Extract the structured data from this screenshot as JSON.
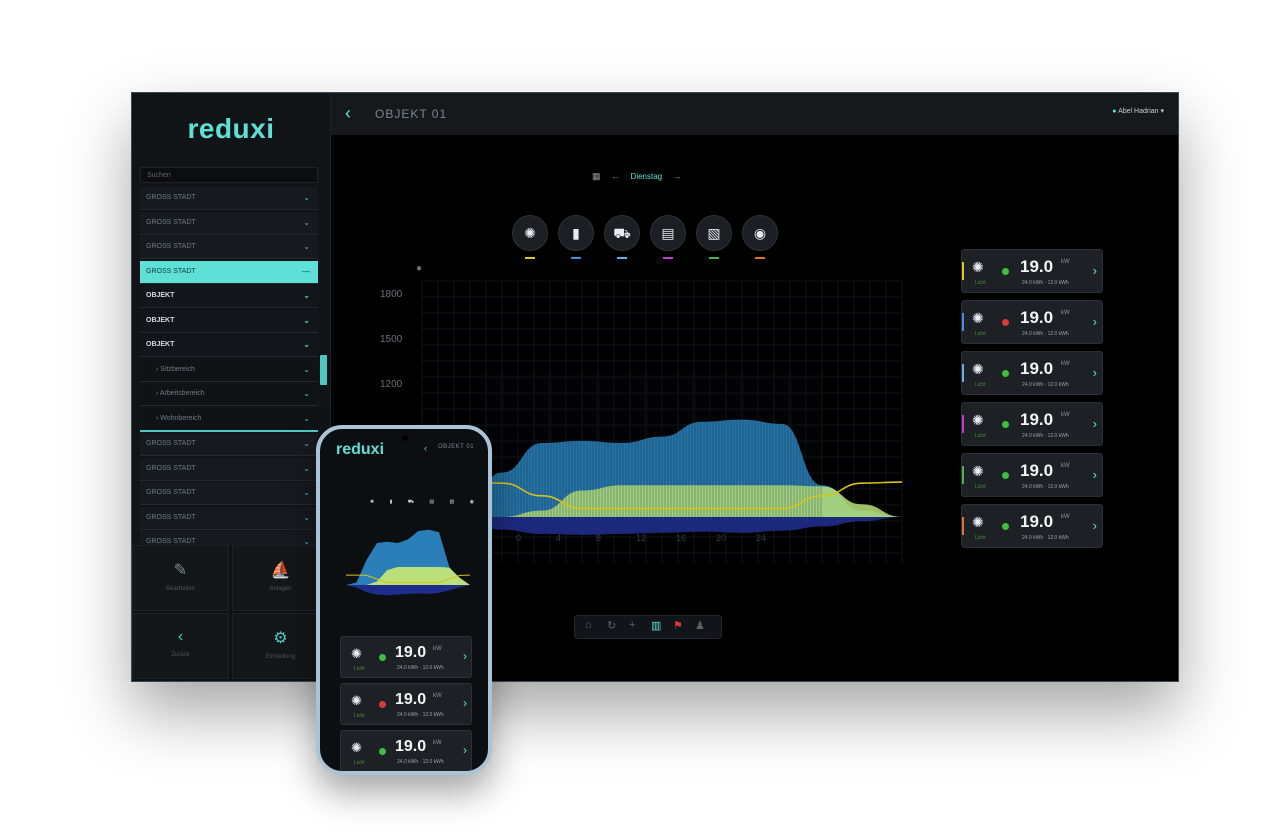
{
  "app": {
    "logo": "reduxi"
  },
  "header": {
    "back_glyph": "‹",
    "title": "OBJEKT 01",
    "user_name": "Abel Hadrian"
  },
  "sidebar": {
    "search_placeholder": "Suchen",
    "items": [
      {
        "label": "GROSS STADT",
        "state": "default"
      },
      {
        "label": "GROSS STADT",
        "state": "default"
      },
      {
        "label": "GROSS STADT",
        "state": "default"
      },
      {
        "label": "GROSS STADT",
        "state": "active"
      },
      {
        "label": "OBJEKT",
        "state": "bold"
      },
      {
        "label": "OBJEKT",
        "state": "bold"
      },
      {
        "label": "OBJEKT",
        "state": "bold"
      },
      {
        "label": "› Sitzbereich",
        "state": "sub"
      },
      {
        "label": "› Arbeitsbereich",
        "state": "sub"
      },
      {
        "label": "› Wohnbereich",
        "state": "sub-line"
      },
      {
        "label": "GROSS STADT",
        "state": "default"
      },
      {
        "label": "GROSS STADT",
        "state": "default"
      },
      {
        "label": "GROSS STADT",
        "state": "default"
      },
      {
        "label": "GROSS STADT",
        "state": "default"
      },
      {
        "label": "GROSS STADT",
        "state": "default"
      }
    ],
    "tiles": [
      {
        "icon": "edit-icon",
        "glyph": "✎",
        "label": "Bearbeiten"
      },
      {
        "icon": "boat-icon",
        "glyph": "⛵",
        "label": "Anlagen"
      },
      {
        "icon": "back-icon",
        "glyph": "‹",
        "label": "Zurück"
      },
      {
        "icon": "settings-icon",
        "glyph": "⚙",
        "label": "Einstellung"
      }
    ]
  },
  "date_nav": {
    "calendar_glyph": "▦",
    "prev_glyph": "←",
    "date": "Dienstag",
    "next_glyph": "→"
  },
  "categories": [
    {
      "icon": "light-icon",
      "glyph": "✺",
      "color": "#d9c81f"
    },
    {
      "icon": "battery-icon",
      "glyph": "▮",
      "color": "#3d8fe3"
    },
    {
      "icon": "car-icon",
      "glyph": "⛟",
      "color": "#5fb0e6"
    },
    {
      "icon": "appliance-icon",
      "glyph": "▤",
      "color": "#c23ad6"
    },
    {
      "icon": "document-icon",
      "glyph": "▧",
      "color": "#49b34d"
    },
    {
      "icon": "gauge-icon",
      "glyph": "◉",
      "color": "#e0742b"
    }
  ],
  "chart_data": {
    "type": "area",
    "y_ticks": [
      "1800",
      "1500",
      "1200"
    ],
    "x_ticks": [
      "0",
      "4",
      "8",
      "12",
      "16",
      "20",
      "24"
    ],
    "series": [
      {
        "values": [
          0,
          40,
          420,
          700,
          720,
          700,
          760,
          900,
          920,
          880,
          300,
          60,
          0
        ]
      },
      {
        "values": [
          0,
          0,
          0,
          60,
          250,
          300,
          300,
          300,
          300,
          300,
          290,
          120,
          0
        ]
      },
      {
        "values": [
          0,
          -40,
          -120,
          -160,
          -170,
          -160,
          -150,
          -140,
          -150,
          -130,
          -90,
          -40,
          0
        ]
      },
      {
        "values": [
          330,
          330,
          320,
          200,
          80,
          80,
          80,
          80,
          80,
          80,
          200,
          320,
          330
        ]
      }
    ]
  },
  "toolbar_icons": [
    {
      "icon": "home-icon",
      "glyph": "⌂"
    },
    {
      "icon": "refresh-icon",
      "glyph": "↻"
    },
    {
      "icon": "plus-icon",
      "glyph": "+"
    },
    {
      "icon": "chart-icon",
      "glyph": "▥"
    },
    {
      "icon": "alert-icon",
      "glyph": "⚑"
    },
    {
      "icon": "user-icon",
      "glyph": "♟"
    }
  ],
  "devices": [
    {
      "value": "19.0",
      "unit": "kW",
      "sub": "24.0 kWh · 12.0 kWh",
      "status": "#3fbf3f",
      "edge": "#d9c81f",
      "bulb_label": "Licht"
    },
    {
      "value": "19.0",
      "unit": "kW",
      "sub": "24.0 kWh · 12.0 kWh",
      "status": "#d93a3a",
      "edge": "#3d8fe3",
      "bulb_label": "Licht"
    },
    {
      "value": "19.0",
      "unit": "kW",
      "sub": "24.0 kWh · 12.0 kWh",
      "status": "#3fbf3f",
      "edge": "#5fb0e6",
      "bulb_label": "Licht"
    },
    {
      "value": "19.0",
      "unit": "kW",
      "sub": "24.0 kWh · 12.0 kWh",
      "status": "#3fbf3f",
      "edge": "#c23ad6",
      "bulb_label": "Licht"
    },
    {
      "value": "19.0",
      "unit": "kW",
      "sub": "24.0 kWh · 12.0 kWh",
      "status": "#3fbf3f",
      "edge": "#49b34d",
      "bulb_label": "Licht"
    },
    {
      "value": "19.0",
      "unit": "kW",
      "sub": "24.0 kWh · 12.0 kWh",
      "status": "#3fbf3f",
      "edge": "#e0742b",
      "bulb_label": "Licht"
    }
  ],
  "phone": {
    "logo": "reduxi",
    "title": "OBJEKT 01",
    "category_glyphs": "✺ ▮ ⛟ ▤ ▧ ◉",
    "devices": [
      {
        "value": "19.0",
        "unit": "kW",
        "sub": "24.0 kWh · 12.0 kWh",
        "status": "#3fbf3f",
        "bulb_label": "Licht"
      },
      {
        "value": "19.0",
        "unit": "kW",
        "sub": "24.0 kWh · 12.0 kWh",
        "status": "#d93a3a",
        "bulb_label": "Licht"
      },
      {
        "value": "19.0",
        "unit": "kW",
        "sub": "24.0 kWh · 12.0 kWh",
        "status": "#3fbf3f",
        "bulb_label": "Licht"
      }
    ]
  },
  "colors": {
    "accent": "#5fe0d6",
    "blue_area": "#2a7fb8",
    "green_area": "#b9e07a",
    "navy_area": "#1f2c8a",
    "yellow_line": "#d6c21a"
  }
}
